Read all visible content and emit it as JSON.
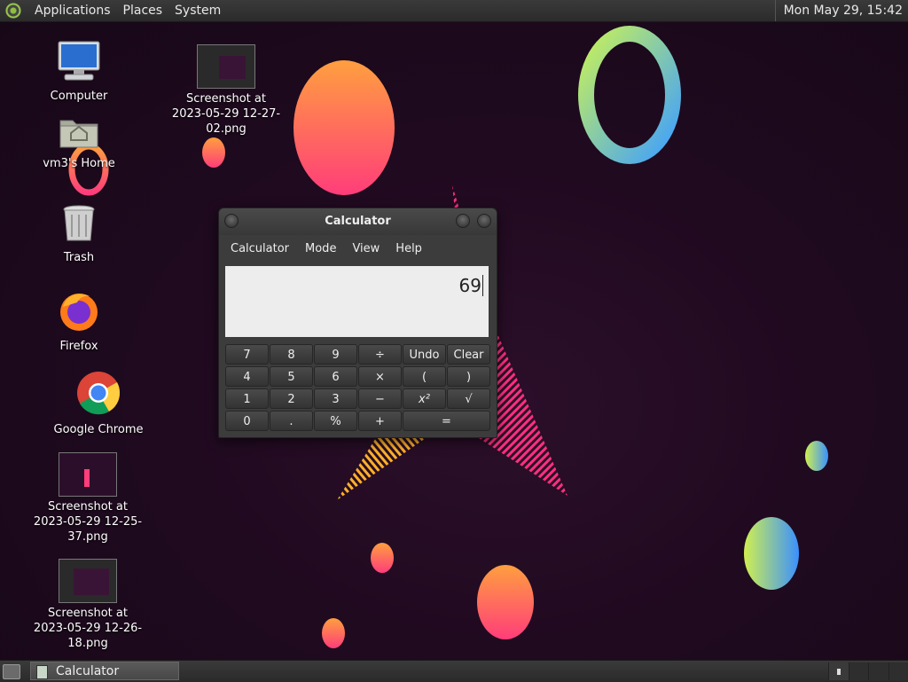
{
  "top_panel": {
    "menus": [
      "Applications",
      "Places",
      "System"
    ],
    "clock": "Mon May 29, 15:42"
  },
  "desktop_icons": {
    "computer": "Computer",
    "home": "vm3's Home",
    "trash": "Trash",
    "firefox": "Firefox",
    "chrome": "Google Chrome",
    "shot1": "Screenshot at 2023-05-29 12-27-02.png",
    "shot2": "Screenshot at 2023-05-29 12-25-37.png",
    "shot3": "Screenshot at 2023-05-29 12-26-18.png"
  },
  "calculator": {
    "title": "Calculator",
    "menus": [
      "Calculator",
      "Mode",
      "View",
      "Help"
    ],
    "display_value": "69",
    "keys": [
      [
        "7",
        "8",
        "9",
        "÷",
        "Undo",
        "Clear"
      ],
      [
        "4",
        "5",
        "6",
        "×",
        "(",
        ")"
      ],
      [
        "1",
        "2",
        "3",
        "−",
        "x²",
        "√"
      ],
      [
        "0",
        ".",
        "%",
        "+",
        "="
      ]
    ]
  },
  "taskbar": {
    "task_label": "Calculator"
  }
}
